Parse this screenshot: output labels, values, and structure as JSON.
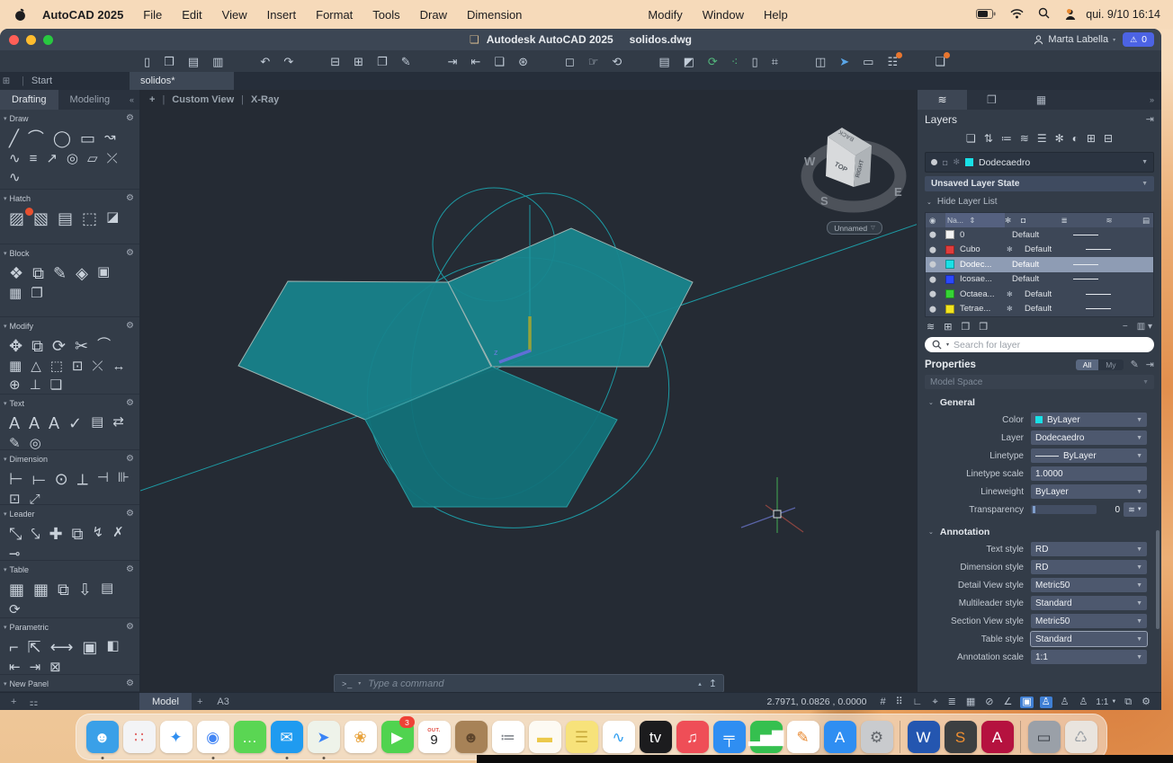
{
  "menubar": {
    "app_name": "AutoCAD 2025",
    "items": [
      "File",
      "Edit",
      "View",
      "Insert",
      "Format",
      "Tools",
      "Draw",
      "Dimension"
    ],
    "items_right": [
      "Modify",
      "Window",
      "Help"
    ],
    "clock": "qui. 9/10 16:14"
  },
  "titlebar": {
    "app": "Autodesk AutoCAD 2025",
    "doc": "solidos.dwg",
    "user": "Marta Labella",
    "alerts": "0"
  },
  "toolbar": {
    "icons": [
      {
        "g": "▯"
      },
      {
        "g": "❒"
      },
      {
        "g": "▤"
      },
      {
        "g": "▥"
      },
      {
        "g": "↶",
        "gap": true
      },
      {
        "g": "↷"
      },
      {
        "g": "⊟",
        "gap": true
      },
      {
        "g": "⊞"
      },
      {
        "g": "❐"
      },
      {
        "g": "✎"
      },
      {
        "g": "⇥",
        "gap": true
      },
      {
        "g": "⇤"
      },
      {
        "g": "❑"
      },
      {
        "g": "⊛"
      },
      {
        "g": "◻",
        "gap": true
      },
      {
        "g": "☞"
      },
      {
        "g": "⟲"
      },
      {
        "g": "▤",
        "gap": true
      },
      {
        "g": "◩"
      },
      {
        "g": "⟳",
        "c": "#53b97d"
      },
      {
        "g": "⁖",
        "c": "#53b97d"
      },
      {
        "g": "▯"
      },
      {
        "g": "⌗"
      },
      {
        "g": "◫",
        "gap": true
      },
      {
        "g": "➤",
        "c": "#5aa6e8"
      },
      {
        "g": "▭"
      },
      {
        "g": "☷",
        "dot": true
      },
      {
        "g": "❏",
        "gap": true,
        "dot": true
      }
    ]
  },
  "doc_tabs": {
    "start": "Start",
    "active": "solidos*"
  },
  "left_panel": {
    "tabs": [
      {
        "label": "Drafting",
        "active": true
      },
      {
        "label": "Modeling",
        "active": false
      }
    ],
    "collapse": "«",
    "panels": [
      {
        "name": "Draw",
        "icons": [
          "╱",
          "⌒",
          "◯",
          "▭",
          "↝",
          "∿",
          "≡",
          "↗",
          "◎",
          "▱",
          "⤫",
          "∿"
        ]
      },
      {
        "name": "Hatch",
        "icons": [
          "▨",
          "▧",
          "▤",
          "⬚",
          "◪"
        ]
      },
      {
        "name": "Block",
        "icons": [
          "❖",
          "⧉",
          "✎",
          "◈",
          "▣",
          "▦",
          "❐"
        ]
      },
      {
        "name": "Modify",
        "icons": [
          "✥",
          "⧉",
          "⟳",
          "✂",
          "⌒",
          "▦",
          "△",
          "⬚",
          "⊡",
          "⤫",
          "↔",
          "⊕",
          "⊥",
          "❏"
        ]
      },
      {
        "name": "Text",
        "icons": [
          "A",
          "A",
          "A",
          "✓",
          "▤",
          "⇄",
          "✎",
          "◎"
        ]
      },
      {
        "name": "Dimension",
        "icons": [
          "⊢",
          "⟝",
          "⊙",
          "⟂",
          "⊣",
          "⊪",
          "⊡",
          "⤢"
        ]
      },
      {
        "name": "Leader",
        "icons": [
          "⤡",
          "⤥",
          "✚",
          "⧉",
          "↯",
          "✗",
          "⊸"
        ]
      },
      {
        "name": "Table",
        "icons": [
          "▦",
          "▦",
          "⧉",
          "⇩",
          "▤",
          "⟳"
        ]
      },
      {
        "name": "Parametric",
        "icons": [
          "⌐",
          "⇱",
          "⟷",
          "▣",
          "◧",
          "⇤",
          "⇥",
          "⊠"
        ]
      },
      {
        "name": "New Panel",
        "icons": []
      }
    ],
    "bottom_icons": [
      "+",
      "⚏"
    ]
  },
  "viewport": {
    "add": "+",
    "view_name": "Custom View",
    "visual_style": "X-Ray",
    "named_view": "Unnamed",
    "viewcube": {
      "top_face": "TOP",
      "right_face": "RIGHT",
      "back_face": "BACK",
      "w": "W",
      "s": "S",
      "e": "E"
    },
    "command": {
      "prompt": ">_",
      "placeholder": "Type a command"
    }
  },
  "layers_panel": {
    "title": "Layers",
    "action_icons": [
      "❏",
      "⇅",
      "≔",
      "≋",
      "☰",
      "✻",
      "◐",
      "⊞",
      "⊟"
    ],
    "current_layer": "Dodecaedro",
    "current_swatch": "#19e0e6",
    "layer_state": "Unsaved Layer State",
    "hide_list": "Hide Layer List",
    "table": {
      "eye_header": "◉",
      "name_header": "Na...",
      "sort_glyph": "⇕",
      "freeze_header": "✻",
      "lock_header": "◘",
      "lw_header": "≣",
      "rows": [
        {
          "name": "0",
          "color": "#f2f2f2",
          "frozen": false,
          "lineweight": "Default"
        },
        {
          "name": "Cubo",
          "color": "#e03c3c",
          "frozen": true,
          "lineweight": "Default"
        },
        {
          "name": "Dodec...",
          "color": "#19e0e6",
          "frozen": false,
          "lineweight": "Default",
          "selected": true
        },
        {
          "name": "Icosae...",
          "color": "#2b48ff",
          "frozen": false,
          "lineweight": "Default"
        },
        {
          "name": "Octaea...",
          "color": "#35d435",
          "frozen": true,
          "lineweight": "Default"
        },
        {
          "name": "Tetrae...",
          "color": "#f2e41f",
          "frozen": true,
          "lineweight": "Default"
        }
      ]
    },
    "tool_icons": [
      "≋",
      "⊞",
      "❒",
      "❐"
    ],
    "minus": "−",
    "columns_btn": "▥",
    "search_placeholder": "Search for layer"
  },
  "properties_panel": {
    "title": "Properties",
    "filters": [
      {
        "label": "All",
        "active": true
      },
      {
        "label": "My",
        "active": false
      }
    ],
    "space": "Model Space",
    "general_label": "General",
    "color_label": "Color",
    "color_value": "ByLayer",
    "color_swatch": "#19e0e6",
    "layer_label": "Layer",
    "layer_value": "Dodecaedro",
    "linetype_label": "Linetype",
    "linetype_value": "ByLayer",
    "ltscale_label": "Linetype scale",
    "ltscale_value": "1.0000",
    "lineweight_label": "Lineweight",
    "lineweight_value": "ByLayer",
    "transparency_label": "Transparency",
    "transparency_value": "0",
    "annotation_label": "Annotation",
    "annotation_rows": [
      {
        "label": "Text style",
        "value": "RD"
      },
      {
        "label": "Dimension style",
        "value": "RD"
      },
      {
        "label": "Detail View style",
        "value": "Metric50"
      },
      {
        "label": "Multileader style",
        "value": "Standard"
      },
      {
        "label": "Section View style",
        "value": "Metric50"
      },
      {
        "label": "Table style",
        "value": "Standard",
        "focus": true
      },
      {
        "label": "Annotation scale",
        "value": "1:1"
      }
    ]
  },
  "statusbar": {
    "model": "Model",
    "plus": "+",
    "layout": "A3",
    "coords": "2.7971, 0.0826 , 0.0000",
    "icons": [
      {
        "g": "#"
      },
      {
        "g": "⠿"
      },
      {
        "g": "∟"
      },
      {
        "g": "⌖"
      },
      {
        "g": "≣"
      },
      {
        "g": "▦"
      },
      {
        "g": "⊘"
      },
      {
        "g": "∠"
      },
      {
        "g": "▣",
        "active": true
      },
      {
        "g": "♙",
        "active": true
      },
      {
        "g": "♙"
      },
      {
        "g": "♙"
      }
    ],
    "scale": "1:1",
    "icons_end": [
      {
        "g": "⧉"
      },
      {
        "g": "⚙"
      }
    ]
  },
  "dock": {
    "apps": [
      {
        "name": "finder",
        "glyph": "☻",
        "bg": "#3aa0e8",
        "fg": "#ffffff",
        "dot": true
      },
      {
        "name": "launchpad",
        "glyph": "∷",
        "bg": "#f3f4f6",
        "fg": "#e06060"
      },
      {
        "name": "safari",
        "glyph": "✦",
        "bg": "#ffffff",
        "fg": "#2f8ef0"
      },
      {
        "name": "chrome",
        "glyph": "◉",
        "bg": "#ffffff",
        "fg": "#4285f4",
        "dot": true
      },
      {
        "name": "messages",
        "glyph": "…",
        "bg": "#5ad653",
        "fg": "#ffffff"
      },
      {
        "name": "mail",
        "glyph": "✉",
        "bg": "#1f9bf0",
        "fg": "#ffffff",
        "dot": true
      },
      {
        "name": "maps",
        "glyph": "➤",
        "bg": "#eef3ea",
        "fg": "#3a84f6",
        "dot": true
      },
      {
        "name": "photos",
        "glyph": "❀",
        "bg": "#ffffff",
        "fg": "#e8a33d"
      },
      {
        "name": "facetime",
        "glyph": "▶",
        "bg": "#50d34f",
        "fg": "#ffffff",
        "badge": "3"
      },
      {
        "name": "calendar",
        "month": "OUT.",
        "day": "9",
        "bg": "#ffffff"
      },
      {
        "name": "contacts",
        "glyph": "☻",
        "bg": "#a78257",
        "fg": "#5e452c"
      },
      {
        "name": "reminders",
        "glyph": "≔",
        "bg": "#ffffff",
        "fg": "#7a7f87"
      },
      {
        "name": "notes",
        "glyph": "▬",
        "bg": "#fdfaf3",
        "fg": "#ecc94b",
        "dot": true
      },
      {
        "name": "stickies",
        "glyph": "☰",
        "bg": "#f7e27a",
        "fg": "#c9ab3c",
        "dot": true
      },
      {
        "name": "freeform",
        "glyph": "∿",
        "bg": "#ffffff",
        "fg": "#2f9ef0"
      },
      {
        "name": "appletv",
        "glyph": "tv",
        "bg": "#1c1c1e",
        "fg": "#ffffff"
      },
      {
        "name": "music",
        "glyph": "♫",
        "bg": "#ef4e57",
        "fg": "#ffffff",
        "dot": true
      },
      {
        "name": "keynote",
        "glyph": "╤",
        "bg": "#2f8ef2",
        "fg": "#ffffff"
      },
      {
        "name": "numbers",
        "glyph": "▂▅▇",
        "bg": "#35c04f",
        "fg": "#ffffff"
      },
      {
        "name": "pages",
        "glyph": "✎",
        "bg": "#ffffff",
        "fg": "#e8882f"
      },
      {
        "name": "appstore",
        "glyph": "A",
        "bg": "#2f8ef2",
        "fg": "#ffffff"
      },
      {
        "name": "settings",
        "glyph": "⚙",
        "bg": "#c9cbce",
        "fg": "#5f6368",
        "divider_after": true
      },
      {
        "name": "word",
        "glyph": "W",
        "bg": "#2456b0",
        "fg": "#ffffff",
        "dot": true
      },
      {
        "name": "sublime",
        "glyph": "S",
        "bg": "#3c3f41",
        "fg": "#ef8f31",
        "dot": true
      },
      {
        "name": "autocad",
        "glyph": "A",
        "bg": "#b5123f",
        "fg": "#ffffff",
        "dot": true,
        "divider_after": true
      },
      {
        "name": "window-thumbnail",
        "glyph": "▭",
        "bg": "#9aa0a8",
        "fg": "#3a4048"
      },
      {
        "name": "trash",
        "glyph": "♺",
        "bg": "#e9e4de",
        "fg": "#9aa0a6"
      }
    ]
  }
}
